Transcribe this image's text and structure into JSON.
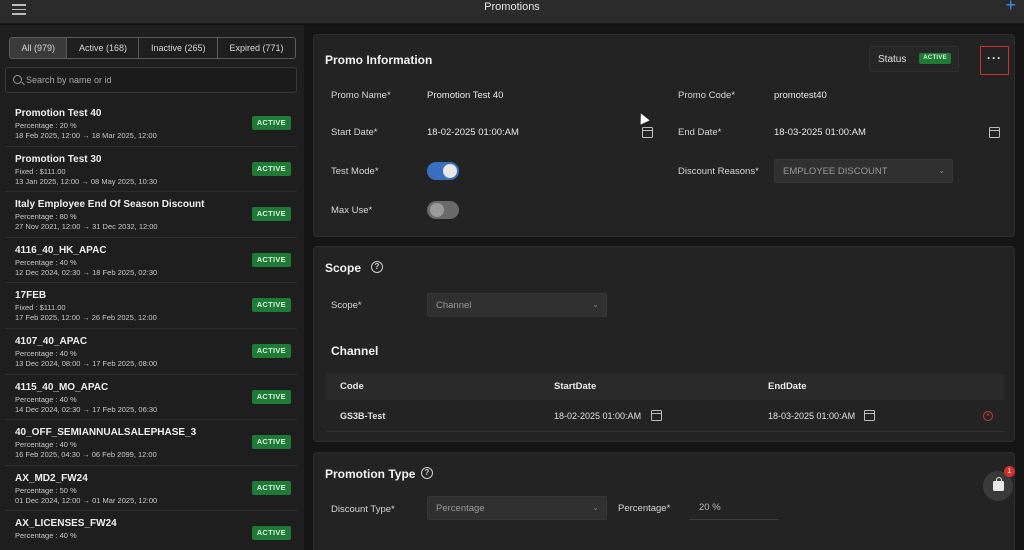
{
  "topbar": {
    "title": "Promotions",
    "menu_icon": "hamburger-icon",
    "add_icon": "plus-icon"
  },
  "filters": {
    "tabs": [
      {
        "label": "All (979)"
      },
      {
        "label": "Active (168)"
      },
      {
        "label": "Inactive (265)"
      },
      {
        "label": "Expired (771)"
      }
    ],
    "active_tab": "All (979)"
  },
  "search": {
    "placeholder": "Search by name or id",
    "value": ""
  },
  "promotions": [
    {
      "name": "Promotion Test 40",
      "type": "Percentage : 20 %",
      "dates": "18 Feb 2025, 12:00 → 18 Mar 2025, 12:00",
      "status": "ACTIVE"
    },
    {
      "name": "Promotion Test 30",
      "type": "Fixed : $111.00",
      "dates": "13 Jan 2025, 12:00 → 08 May 2025, 10:30",
      "status": "ACTIVE"
    },
    {
      "name": "Italy Employee End Of Season Discount",
      "type": "Percentage : 80 %",
      "dates": "27 Nov 2021, 12:00 → 31 Dec 2032, 12:00",
      "status": "ACTIVE"
    },
    {
      "name": "4116_40_HK_APAC",
      "type": "Percentage : 40 %",
      "dates": "12 Dec 2024, 02:30 → 18 Feb 2025, 02:30",
      "status": "ACTIVE"
    },
    {
      "name": "17FEB",
      "type": "Fixed : $111.00",
      "dates": "17 Feb 2025, 12:00 → 26 Feb 2025, 12:00",
      "status": "ACTIVE"
    },
    {
      "name": "4107_40_APAC",
      "type": "Percentage : 40 %",
      "dates": "13 Dec 2024, 08:00 → 17 Feb 2025, 08:00",
      "status": "ACTIVE"
    },
    {
      "name": "4115_40_MO_APAC",
      "type": "Percentage : 40 %",
      "dates": "14 Dec 2024, 02:30 → 17 Feb 2025, 06:30",
      "status": "ACTIVE"
    },
    {
      "name": "40_OFF_SEMIANNUALSALEPHASE_3",
      "type": "Percentage : 40 %",
      "dates": "16 Feb 2025, 04:30 → 06 Feb 2099, 12:00",
      "status": "ACTIVE"
    },
    {
      "name": "AX_MD2_FW24",
      "type": "Percentage : 50 %",
      "dates": "01 Dec 2024, 12:00 → 01 Mar 2025, 12:00",
      "status": "ACTIVE"
    },
    {
      "name": "AX_LICENSES_FW24",
      "type": "Percentage : 40 %",
      "dates": "",
      "status": "ACTIVE"
    }
  ],
  "promo_info": {
    "title": "Promo Information",
    "status_label": "Status",
    "status_value": "ACTIVE",
    "more_label": "···",
    "promo_name_label": "Promo Name*",
    "promo_name": "Promotion Test 40",
    "promo_code_label": "Promo Code*",
    "promo_code": "promotest40",
    "start_date_label": "Start Date*",
    "start_date": "18-02-2025 01:00:AM",
    "end_date_label": "End Date*",
    "end_date": "18-03-2025 01:00:AM",
    "test_mode_label": "Test Mode*",
    "test_mode_on": true,
    "discount_reasons_label": "Discount Reasons*",
    "discount_reason": "EMPLOYEE DISCOUNT",
    "max_use_label": "Max Use*",
    "max_use_on": false
  },
  "scope": {
    "title": "Scope",
    "scope_label": "Scope*",
    "scope_value": "Channel",
    "channel_title": "Channel",
    "columns": [
      "Code",
      "StartDate",
      "EndDate"
    ],
    "rows": [
      {
        "code": "GS3B-Test",
        "start": "18-02-2025 01:00:AM",
        "end": "18-03-2025 01:00:AM"
      }
    ]
  },
  "promotion_type": {
    "title": "Promotion Type",
    "discount_type_label": "Discount Type*",
    "discount_type": "Percentage",
    "percentage_label": "Percentage*",
    "percentage_value": "20 %"
  },
  "cart_fab": {
    "count": "1",
    "icon": "shopping-bag-icon"
  },
  "colors": {
    "accent": "#3a6fbf",
    "active_badge": "#1f7a36",
    "danger": "#d32f2f",
    "plus": "#3b8ff0"
  }
}
